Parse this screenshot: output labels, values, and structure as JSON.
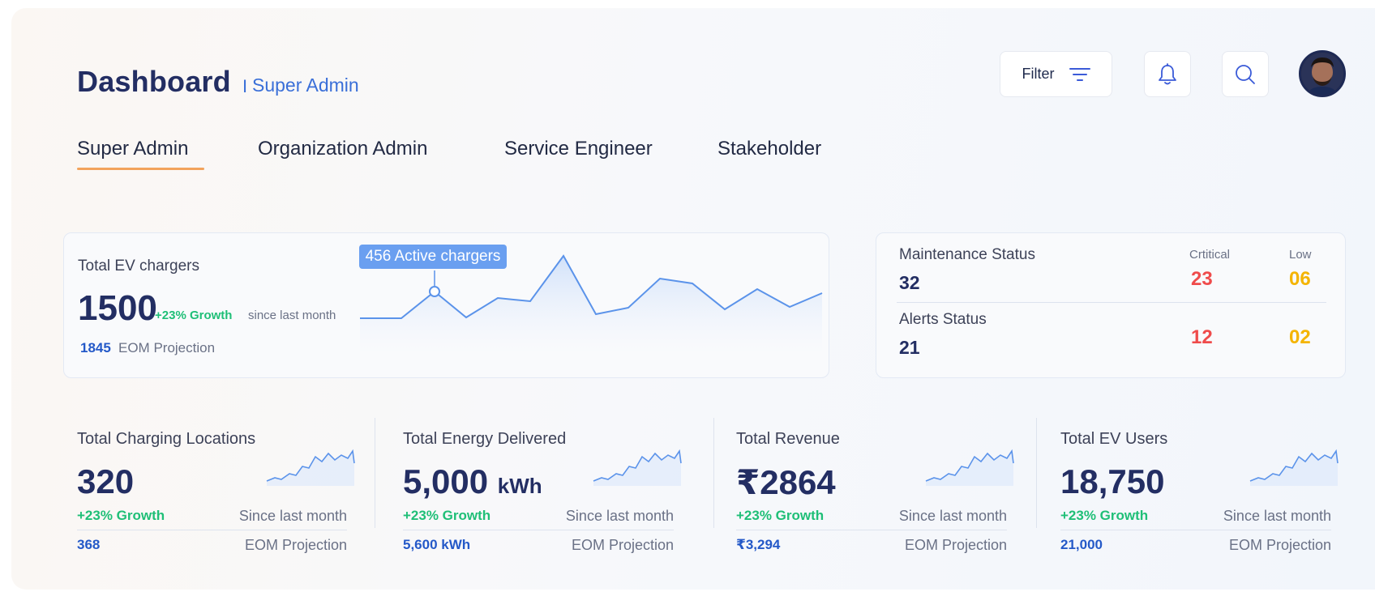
{
  "header": {
    "title": "Dashboard",
    "separator": "I",
    "subtitle": "Super Admin",
    "filter_label": "Filter"
  },
  "tabs": [
    {
      "label": "Super Admin",
      "active": true
    },
    {
      "label": "Organization Admin",
      "active": false
    },
    {
      "label": "Service Engineer",
      "active": false
    },
    {
      "label": "Stakeholder",
      "active": false
    }
  ],
  "chargers_card": {
    "label": "Total EV chargers",
    "value": "1500",
    "growth": "+23% Growth",
    "since": "since last month",
    "projection_value": "1845",
    "projection_label": "EOM Projection",
    "tooltip": "456 Active chargers"
  },
  "status_card": {
    "col_critical": "Crtitical",
    "col_low": "Low",
    "maintenance": {
      "label": "Maintenance Status",
      "value": "32",
      "critical": "23",
      "low": "06"
    },
    "alerts": {
      "label": "Alerts Status",
      "value": "21",
      "critical": "12",
      "low": "02"
    }
  },
  "stats": [
    {
      "label": "Total Charging Locations",
      "value": "320",
      "unit": "",
      "growth": "+23% Growth",
      "since": "Since last month",
      "projection": "368",
      "projection_label": "EOM Projection"
    },
    {
      "label": "Total Energy Delivered",
      "value": "5,000",
      "unit": "kWh",
      "growth": "+23% Growth",
      "since": "Since last month",
      "projection": "5,600 kWh",
      "projection_label": "EOM Projection"
    },
    {
      "label": "Total Revenue",
      "value": "₹2864",
      "unit": "",
      "growth": "+23% Growth",
      "since": "Since last month",
      "projection": "₹3,294",
      "projection_label": "EOM Projection"
    },
    {
      "label": "Total EV Users",
      "value": "18,750",
      "unit": "",
      "growth": "+23% Growth",
      "since": "Since last month",
      "projection": "21,000",
      "projection_label": "EOM Projection"
    }
  ],
  "colors": {
    "accent": "#f2a35c",
    "primary": "#232e63",
    "link_blue": "#3a6fd8",
    "growth_green": "#1fbf77",
    "critical_red": "#ef4b4b",
    "low_yellow": "#f4b400",
    "chart_line": "#5b93ea"
  },
  "icons": {
    "filter": "filter-lines-icon",
    "notifications": "bell-icon",
    "search": "search-icon",
    "profile": "avatar"
  }
}
